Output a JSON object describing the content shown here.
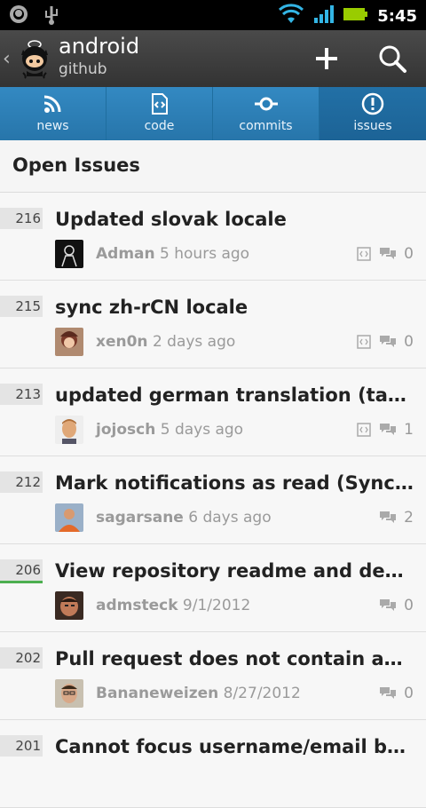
{
  "status_bar": {
    "time": "5:45",
    "left_icons": [
      "github-notification-icon",
      "usb-icon"
    ],
    "right_icons": [
      "wifi-icon",
      "signal-icon",
      "battery-icon"
    ]
  },
  "action_bar": {
    "title": "android",
    "subtitle": "github",
    "actions": [
      "add-icon",
      "search-icon"
    ]
  },
  "tabs": [
    {
      "id": "news",
      "label": "news",
      "icon": "rss-icon",
      "active": false
    },
    {
      "id": "code",
      "label": "code",
      "icon": "code-file-icon",
      "active": false
    },
    {
      "id": "commits",
      "label": "commits",
      "icon": "commit-icon",
      "active": false
    },
    {
      "id": "issues",
      "label": "issues",
      "icon": "issue-icon",
      "active": true
    }
  ],
  "section": {
    "title": "Open Issues"
  },
  "issues": [
    {
      "number": "216",
      "title": "Updated slovak locale",
      "author": "Adman",
      "time": "5 hours ago",
      "comments": "0",
      "is_pull_request": true,
      "avatar_color": "#111111"
    },
    {
      "number": "215",
      "title": "sync zh-rCN locale",
      "author": "xen0n",
      "time": "2 days ago",
      "comments": "0",
      "is_pull_request": true,
      "avatar_color": "#8a4b3a"
    },
    {
      "number": "213",
      "title": "updated german translation (tab-t…",
      "author": "jojosch",
      "time": "5 days ago",
      "comments": "1",
      "is_pull_request": true,
      "avatar_color": "#caa27a"
    },
    {
      "number": "212",
      "title": "Mark notifications as read (Sync b…",
      "author": "sagarsane",
      "time": "6 days ago",
      "comments": "2",
      "is_pull_request": false,
      "avatar_color": "#d07a3a"
    },
    {
      "number": "206",
      "title": "View repository readme and descr…",
      "author": "admsteck",
      "time": "9/1/2012",
      "comments": "0",
      "is_pull_request": false,
      "avatar_color": "#6b3c2a"
    },
    {
      "number": "202",
      "title": "Pull request does not contain any …",
      "author": "Bananeweizen",
      "time": "8/27/2012",
      "comments": "0",
      "is_pull_request": false,
      "avatar_color": "#7a6a5a"
    },
    {
      "number": "201",
      "title": "Cannot focus username/email box…",
      "author": "",
      "time": "",
      "comments": "",
      "is_pull_request": false,
      "avatar_color": "#888888"
    }
  ]
}
